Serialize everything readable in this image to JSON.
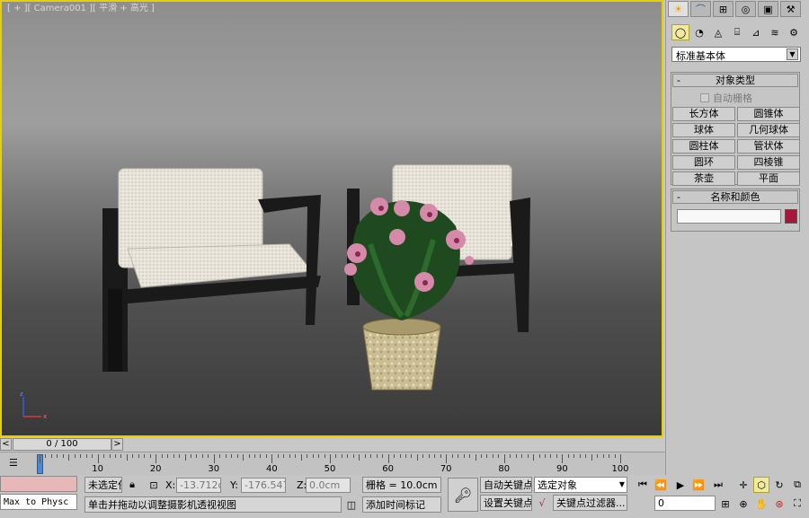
{
  "viewport": {
    "label": "[ + ][ Camera001 ][ 平滑 + 高光 ]"
  },
  "command_panel": {
    "tabs": [
      {
        "icon": "sun-icon",
        "glyph": "☀"
      },
      {
        "icon": "modify-arc-icon",
        "glyph": "⌒"
      },
      {
        "icon": "hierarchy-icon",
        "glyph": "⊞"
      },
      {
        "icon": "motion-icon",
        "glyph": "◎"
      },
      {
        "icon": "display-icon",
        "glyph": "▣"
      },
      {
        "icon": "utilities-hammer-icon",
        "glyph": "⚒"
      }
    ],
    "subtabs": [
      {
        "icon": "geometry-sphere-icon",
        "glyph": "◯"
      },
      {
        "icon": "shapes-icon",
        "glyph": "◔"
      },
      {
        "icon": "lights-icon",
        "glyph": "◬"
      },
      {
        "icon": "cameras-icon",
        "glyph": "⌸"
      },
      {
        "icon": "helpers-icon",
        "glyph": "⊿"
      },
      {
        "icon": "spacewarps-icon",
        "glyph": "≋"
      },
      {
        "icon": "systems-icon",
        "glyph": "⚙"
      }
    ],
    "category_dropdown": "标准基本体",
    "object_type": {
      "title": "对象类型",
      "autogrid_label": "自动栅格",
      "buttons": [
        "长方体",
        "圆锥体",
        "球体",
        "几何球体",
        "圆柱体",
        "管状体",
        "圆环",
        "四棱锥",
        "茶壶",
        "平面"
      ]
    },
    "name_color": {
      "title": "名称和颜色",
      "swatch_color": "#a8173a"
    }
  },
  "time_slider": {
    "prev": "<",
    "position": "0 / 100",
    "next": ">"
  },
  "track_bar": {
    "labels": [
      "0",
      "10",
      "20",
      "30",
      "40",
      "50",
      "60",
      "70",
      "80",
      "90",
      "100"
    ]
  },
  "status": {
    "maxscript_listener": "Max to Physc",
    "selection": "未选定任",
    "x_label": "X:",
    "x_value": "-13.712cm",
    "y_label": "Y:",
    "y_value": "-176.547cm",
    "z_label": "Z:",
    "z_value": "0.0cm",
    "grid": "栅格 = 10.0cm",
    "prompt": "单击并拖动以调整摄影机透视视图",
    "add_time_tag": "添加时间标记",
    "auto_key": "自动关键点",
    "set_key": "设置关键点",
    "selected_object": "选定对象",
    "key_filters": "关键点过滤器...",
    "frame": "0"
  }
}
